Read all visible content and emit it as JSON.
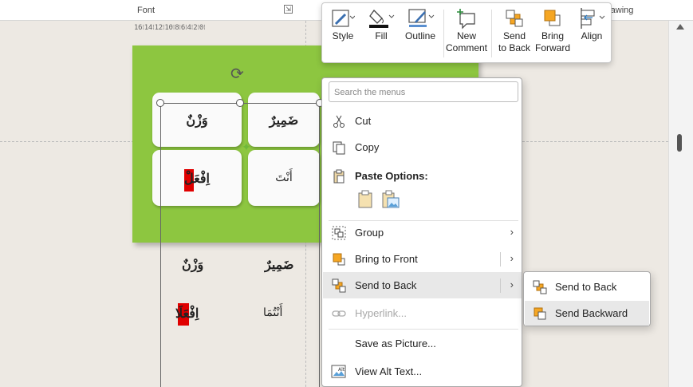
{
  "ribbon": {
    "font_label": "Font",
    "launcher": "⇲",
    "drawing_label": "rawing"
  },
  "ruler": {
    "text": "16⁝14⁝12⁝10⁝8⁝6⁝4⁝2⁝0⁝"
  },
  "mini_toolbar": {
    "style": "Style",
    "fill": "Fill",
    "outline": "Outline",
    "new_comment": [
      "New",
      "Comment"
    ],
    "send_to_back": [
      "Send",
      "to Back"
    ],
    "bring_forward": [
      "Bring",
      "Forward"
    ],
    "align": "Align"
  },
  "slide": {
    "row1": [
      "وَزْنٌ",
      "ضَمِيرٌ"
    ],
    "row2": [
      "اِفْعَلْ",
      "أَنْتَ"
    ],
    "row3": [
      "وَزْنٌ",
      "ضَمِيرٌ"
    ],
    "row4": [
      "اِفْعَلَا",
      "أَنْتُمَا"
    ]
  },
  "context_menu": {
    "search_placeholder": "Search the menus",
    "cut": "Cut",
    "copy": "Copy",
    "paste_options": "Paste Options:",
    "group": "Group",
    "bring_to_front": "Bring to Front",
    "send_to_back": "Send to Back",
    "hyperlink": "Hyperlink...",
    "save_as_picture": "Save as Picture...",
    "view_alt_text": "View Alt Text..."
  },
  "submenu": {
    "send_to_back": "Send to Back",
    "send_backward": "Send Backward"
  },
  "colors": {
    "slide_green": "#8dc640",
    "red_highlight": "#e00000",
    "menu_hover": "#e8e8e8"
  }
}
